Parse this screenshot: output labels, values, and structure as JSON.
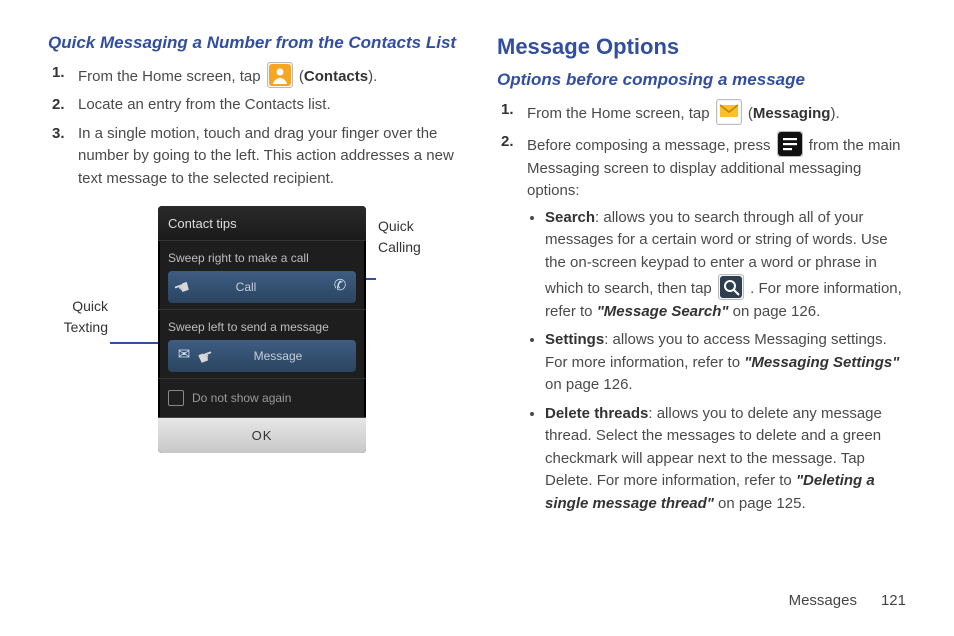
{
  "footer": {
    "section": "Messages",
    "page": "121"
  },
  "left": {
    "heading": "Quick Messaging a Number from the Contacts List",
    "step1_a": "From the Home screen, tap ",
    "step1_b_bold": "Contacts",
    "step1_c": ").",
    "step2": "Locate an entry from the Contacts list.",
    "step3": "In a single motion, touch and drag your finger over the number by going to the left. This action addresses a new text message to the selected recipient.",
    "figure": {
      "title": "Contact tips",
      "sweep_call": "Sweep right to make a call",
      "call_label": "Call",
      "sweep_msg": "Sweep left to send a message",
      "msg_label": "Message",
      "do_not_show": "Do not show again",
      "ok": "OK",
      "callout_left_a": "Quick",
      "callout_left_b": "Texting",
      "callout_right_a": "Quick",
      "callout_right_b": "Calling"
    }
  },
  "right": {
    "h1": "Message Options",
    "h2": "Options before composing a message",
    "step1_a": "From the Home screen, tap ",
    "step1_b_bold": "Messaging",
    "step1_c": ").",
    "step2_a": "Before composing a message, press ",
    "step2_b": " from the main Messaging screen to display additional messaging options:",
    "bullets": {
      "search_lead": "Search",
      "search_body_a": ": allows you to search through all of your messages for a certain word or string of words. Use the on-screen keypad to enter a word or phrase in which to search, then tap ",
      "search_body_b": " . For more information, refer to ",
      "search_ref": "\"Message Search\"",
      "search_tail": " on page 126.",
      "settings_lead": "Settings",
      "settings_body_a": ": allows you to access Messaging settings. For more information, refer to ",
      "settings_ref": "\"Messaging Settings\"",
      "settings_tail": " on page 126.",
      "delete_lead": "Delete threads",
      "delete_body_a": ": allows you to delete any message thread. Select the messages to delete and a green checkmark will appear next to the message. Tap Delete. For more information, refer to ",
      "delete_ref": "\"Deleting a single message thread\"",
      "delete_tail": " on page 125."
    }
  }
}
